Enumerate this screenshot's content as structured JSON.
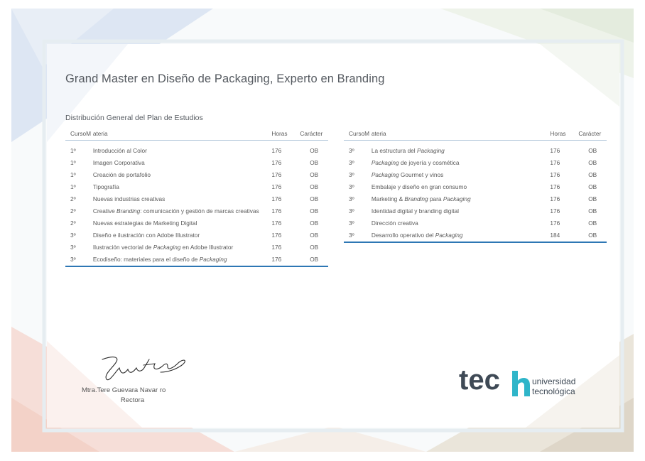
{
  "document": {
    "title": "Grand Master en Diseño de Packaging, Experto en Branding",
    "subtitle": "Distribución General del Plan de Estudios"
  },
  "table_headers": {
    "curso": "CursoM",
    "materia": "ateria",
    "horas": "Horas",
    "caracter": "Carácter"
  },
  "left_table": [
    {
      "curso": "1º",
      "materia": [
        "Introducción al Color"
      ],
      "horas": "176",
      "caracter": "OB"
    },
    {
      "curso": "1º",
      "materia": [
        "Imagen Corporativa"
      ],
      "horas": "176",
      "caracter": "OB"
    },
    {
      "curso": "1º",
      "materia": [
        "Creación de portafolio"
      ],
      "horas": "176",
      "caracter": "OB"
    },
    {
      "curso": "1º",
      "materia": [
        "Tipografía"
      ],
      "horas": "176",
      "caracter": "OB"
    },
    {
      "curso": "2º",
      "materia": [
        "Nuevas industrias creativas"
      ],
      "horas": "176",
      "caracter": "OB"
    },
    {
      "curso": "2º",
      "materia": [
        "Creative ",
        {
          "i": "Branding"
        },
        ": comunicación y gestión de marcas creativas"
      ],
      "horas": "176",
      "caracter": "OB"
    },
    {
      "curso": "2º",
      "materia": [
        "Nuevas estrategias de Marketing Digital"
      ],
      "horas": "176",
      "caracter": "OB"
    },
    {
      "curso": "3º",
      "materia": [
        "Diseño e ilustración con Adobe Illustrator"
      ],
      "horas": "176",
      "caracter": "OB"
    },
    {
      "curso": "3º",
      "materia": [
        "Ilustración vectorial de ",
        {
          "i": "Packaging"
        },
        " en Adobe Illustrator"
      ],
      "horas": "176",
      "caracter": "OB"
    },
    {
      "curso": "3º",
      "materia": [
        "Ecodiseño: materiales para el diseño de ",
        {
          "i": "Packaging"
        }
      ],
      "horas": "176",
      "caracter": "OB"
    }
  ],
  "right_table": [
    {
      "curso": "3º",
      "materia": [
        "La estructura del ",
        {
          "i": "Packaging"
        }
      ],
      "horas": "176",
      "caracter": "OB"
    },
    {
      "curso": "3º",
      "materia": [
        {
          "i": "Packaging"
        },
        " de joyería y cosmética"
      ],
      "horas": "176",
      "caracter": "OB"
    },
    {
      "curso": "3º",
      "materia": [
        {
          "i": "Packaging"
        },
        " Gourmet y vinos"
      ],
      "horas": "176",
      "caracter": "OB"
    },
    {
      "curso": "3º",
      "materia": [
        "Embalaje y diseño en gran consumo"
      ],
      "horas": "176",
      "caracter": "OB"
    },
    {
      "curso": "3º",
      "materia": [
        "Marketing & ",
        {
          "i": "Branding"
        },
        " para ",
        {
          "i": "Packaging"
        }
      ],
      "horas": "176",
      "caracter": "OB"
    },
    {
      "curso": "3º",
      "materia": [
        "Identidad digital y branding digital"
      ],
      "horas": "176",
      "caracter": "OB"
    },
    {
      "curso": "3º",
      "materia": [
        "Dirección creativa"
      ],
      "horas": "176",
      "caracter": "OB"
    },
    {
      "curso": "3º",
      "materia": [
        "Desarrollo operativo del ",
        {
          "i": "Packaging"
        }
      ],
      "horas": "184",
      "caracter": "OB"
    }
  ],
  "signatory": {
    "name": "Mtra.Tere Guevara Navar ro",
    "role": "Rectora"
  },
  "logo": {
    "word": "tec",
    "line1": "universidad",
    "line2": "tecnológica",
    "accent_color": "#2fb5c9"
  }
}
